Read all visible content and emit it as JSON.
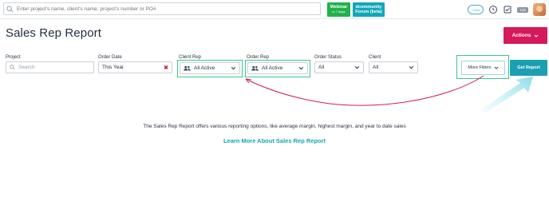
{
  "topbar": {
    "search_placeholder": "Enter project's name, client's name, project's number or PO#",
    "webinar": {
      "line1": "Webinar",
      "line2": "in 7 days"
    },
    "community": {
      "line1": "dcommunity",
      "line2": "Forum (beta)"
    },
    "chat_label": "Chat",
    "count": "125"
  },
  "page": {
    "title": "Sales Rep Report",
    "actions_label": "Actions"
  },
  "filters": {
    "project": {
      "label": "Project",
      "placeholder": "Search"
    },
    "order_date": {
      "label": "Order Date",
      "value": "This Year",
      "clear": "✖"
    },
    "client_rep": {
      "label": "Client Rep",
      "value": "All Active"
    },
    "order_rep": {
      "label": "Order Rep",
      "value": "All Active"
    },
    "order_status": {
      "label": "Order Status",
      "value": "All"
    },
    "client": {
      "label": "Client",
      "value": "All"
    },
    "more_filters_label": "More Filters",
    "get_report_label": "Get Report"
  },
  "main": {
    "info_text": "The Sales Rep Report offers various reporting options, like average margin, highest margin, and year to date sales",
    "learn_more": "Learn More About Sales Rep Report"
  },
  "colors": {
    "accent": "#d6195b",
    "teal": "#1c9fb3",
    "highlight": "#3cc790",
    "arrow": "#d6195b"
  }
}
